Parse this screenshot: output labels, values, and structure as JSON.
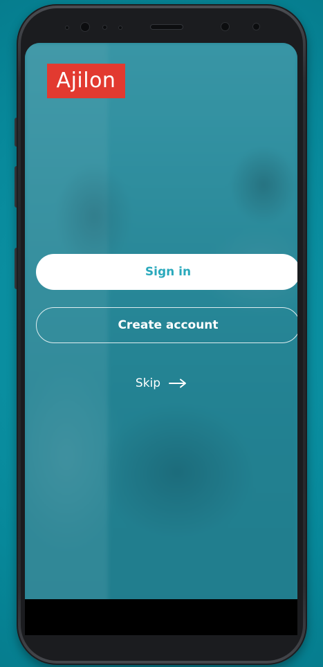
{
  "app": {
    "brand": "Ajilon",
    "brand_color": "#e23a30",
    "accent_color": "#2aa9bc"
  },
  "actions": {
    "sign_in_label": "Sign in",
    "create_account_label": "Create account",
    "skip_label": "Skip",
    "skip_icon": "arrow-right-icon"
  },
  "device": {
    "frame": "smartphone",
    "background_color": "#0a8a9c"
  }
}
